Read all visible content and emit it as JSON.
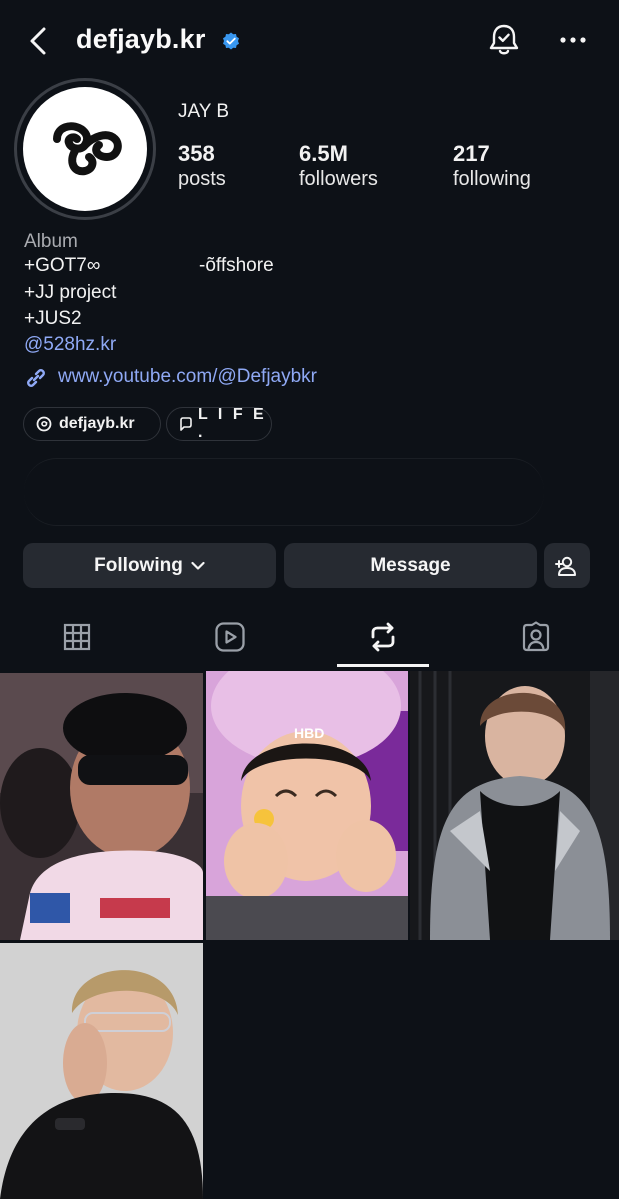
{
  "header": {
    "username": "defjayb.kr",
    "icons": [
      "back-arrow-icon",
      "verified-badge-icon",
      "notification-bell-icon",
      "more-options-icon"
    ]
  },
  "profile": {
    "display_name": "JAY B",
    "stats": {
      "posts": {
        "value": "358",
        "label": "posts"
      },
      "followers": {
        "value": "6.5M",
        "label": "followers"
      },
      "following": {
        "value": "217",
        "label": "following"
      }
    },
    "bio": {
      "category": "Album",
      "line1": "+GOT7∞",
      "line1_right": "-õffshore",
      "line2": "+JJ project",
      "line3": "+JUS2",
      "mention": "@528hz.kr",
      "link": "www.youtube.com/@Defjaybkr"
    },
    "chips": {
      "threads": "defjayb.kr",
      "life": "L I F E ."
    }
  },
  "actions": {
    "following": "Following",
    "message": "Message"
  },
  "tabs": [
    "grid-icon",
    "reels-icon",
    "reposts-icon",
    "tagged-icon"
  ],
  "selected_tab": "reposts",
  "grid": {
    "tile2_overlay": "HBD"
  },
  "colors": {
    "background": "#0d1117",
    "link": "#8fa9f5",
    "verified": "#3897f0",
    "button": "#262a31"
  }
}
